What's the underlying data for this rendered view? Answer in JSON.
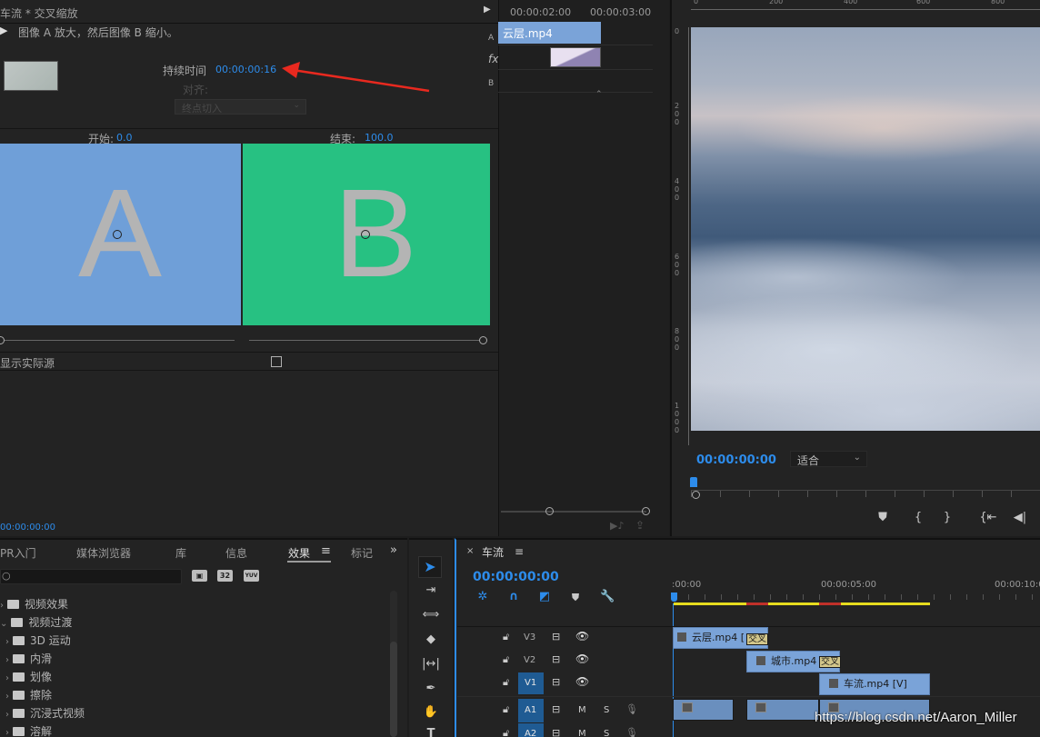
{
  "effect_controls": {
    "title": "车流 * 交叉缩放",
    "description": "图像 A 放大，然后图像 B 缩小。",
    "duration_label": "持续时间",
    "duration_value": "00:00:00:16",
    "align_label": "对齐:",
    "align_value": "终点切入",
    "start_label": "开始:",
    "start_value": "0.0",
    "end_label": "结束:",
    "end_value": "100.0",
    "letter_a": "A",
    "letter_b": "B",
    "show_source_label": "显示实际源",
    "bottom_timecode": "00:00:00:00",
    "mini_timeline": {
      "ruler_times": [
        "00:00:02:00",
        "00:00:03:00"
      ],
      "track_labels": [
        "A",
        "fx",
        "B"
      ],
      "clip_label": "云层.mp4"
    }
  },
  "program_monitor": {
    "ruler_labels": [
      "0",
      "200",
      "400",
      "600",
      "800",
      "1000"
    ],
    "timecode": "00:00:00:00",
    "fit_select": "适合"
  },
  "effects_panel": {
    "tabs": [
      "PR入门",
      "媒体浏览器",
      "库",
      "信息",
      "效果",
      "标记"
    ],
    "active_tab": "效果",
    "tree": [
      {
        "label": "视频效果",
        "level": 0,
        "expanded": false
      },
      {
        "label": "视频过渡",
        "level": 0,
        "expanded": true
      },
      {
        "label": "3D 运动",
        "level": 1
      },
      {
        "label": "内滑",
        "level": 1
      },
      {
        "label": "划像",
        "level": 1
      },
      {
        "label": "擦除",
        "level": 1
      },
      {
        "label": "沉浸式视频",
        "level": 1
      },
      {
        "label": "溶解",
        "level": 1
      }
    ],
    "preset_badges": [
      "32",
      "YUV"
    ]
  },
  "timeline": {
    "sequence_name": "车流",
    "timecode": "00:00:00:00",
    "ruler_times": [
      ":00:00",
      "00:00:05:00",
      "00:00:10:0"
    ],
    "tracks": [
      {
        "name": "V3",
        "type": "video"
      },
      {
        "name": "V2",
        "type": "video"
      },
      {
        "name": "V1",
        "type": "video",
        "targeted": true
      },
      {
        "name": "A1",
        "type": "audio",
        "targeted": true
      },
      {
        "name": "A2",
        "type": "audio",
        "targeted": true
      }
    ],
    "clips": [
      {
        "name": "云层.mp4 [",
        "track": "V3"
      },
      {
        "name": "城市.mp4 [",
        "track": "V2"
      },
      {
        "name": "车流.mp4 [V]",
        "track": "V1"
      }
    ],
    "transition_label": "交叉",
    "mute_label": "M",
    "solo_label": "S"
  },
  "watermark": "https://blog.csdn.net/Aaron_Miller",
  "colors": {
    "accent_blue": "#2d8ceb",
    "clip_blue": "#7aa3d8",
    "preview_a": "#6f9fd8",
    "preview_b": "#27c182",
    "arrow_red": "#e8291f",
    "work_area_yellow": "#e6dc1e"
  }
}
